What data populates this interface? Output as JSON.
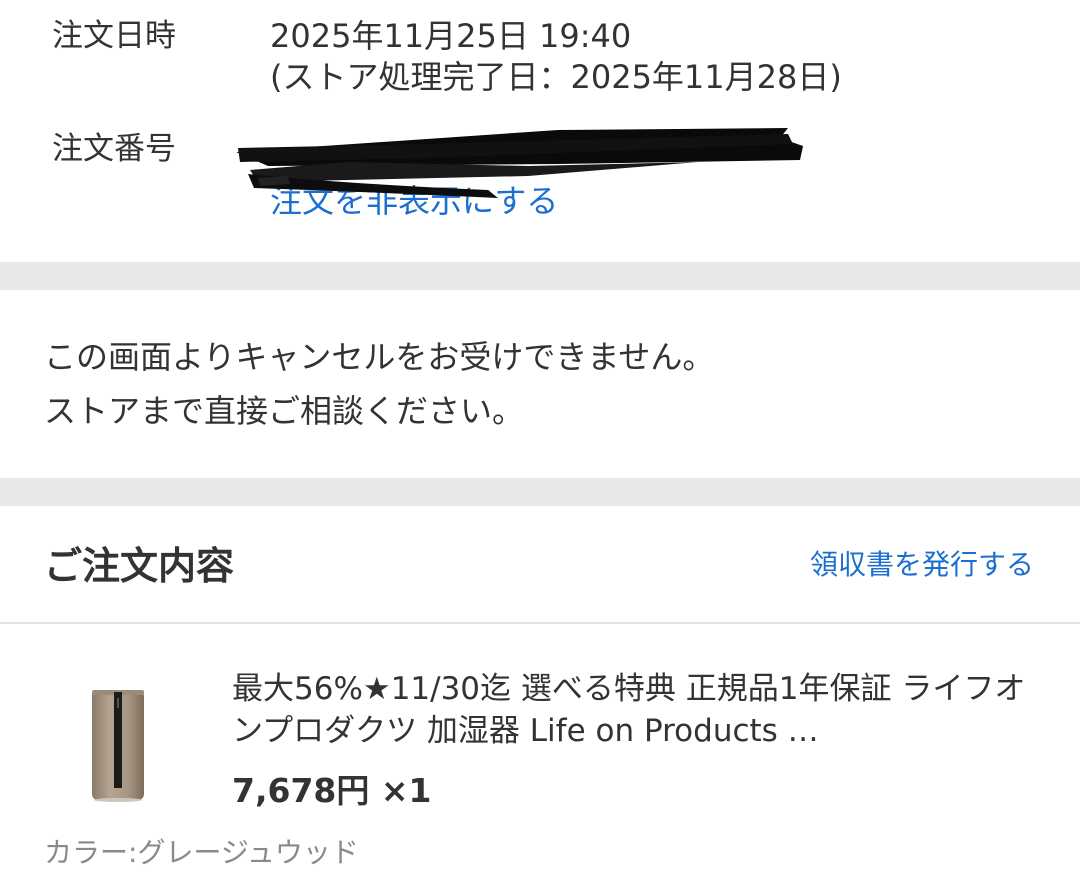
{
  "order_info": {
    "date_label": "注文日時",
    "date_value": "2025年11月25日 19:40",
    "store_complete": "(ストア処理完了日：2025年11月28日)",
    "number_label": "注文番号",
    "number_value": "",
    "hide_link": "注文を非表示にする"
  },
  "notice": {
    "line1": "この画面よりキャンセルをお受けできません。",
    "line2": "ストアまで直接ご相談ください。"
  },
  "order_contents": {
    "title": "ご注文内容",
    "receipt_link": "領収書を発行する"
  },
  "item": {
    "title": "最大56%★11/30迄 選べる特典 正規品1年保証 ライフオンプロダクツ 加湿器 Life on Products …",
    "price": "7,678円 ×1",
    "color": "カラー:グレージュウッド"
  },
  "colors": {
    "link": "#1a6fd1",
    "text": "#333333",
    "muted": "#8a8a8a",
    "band": "#e8e8e8"
  }
}
